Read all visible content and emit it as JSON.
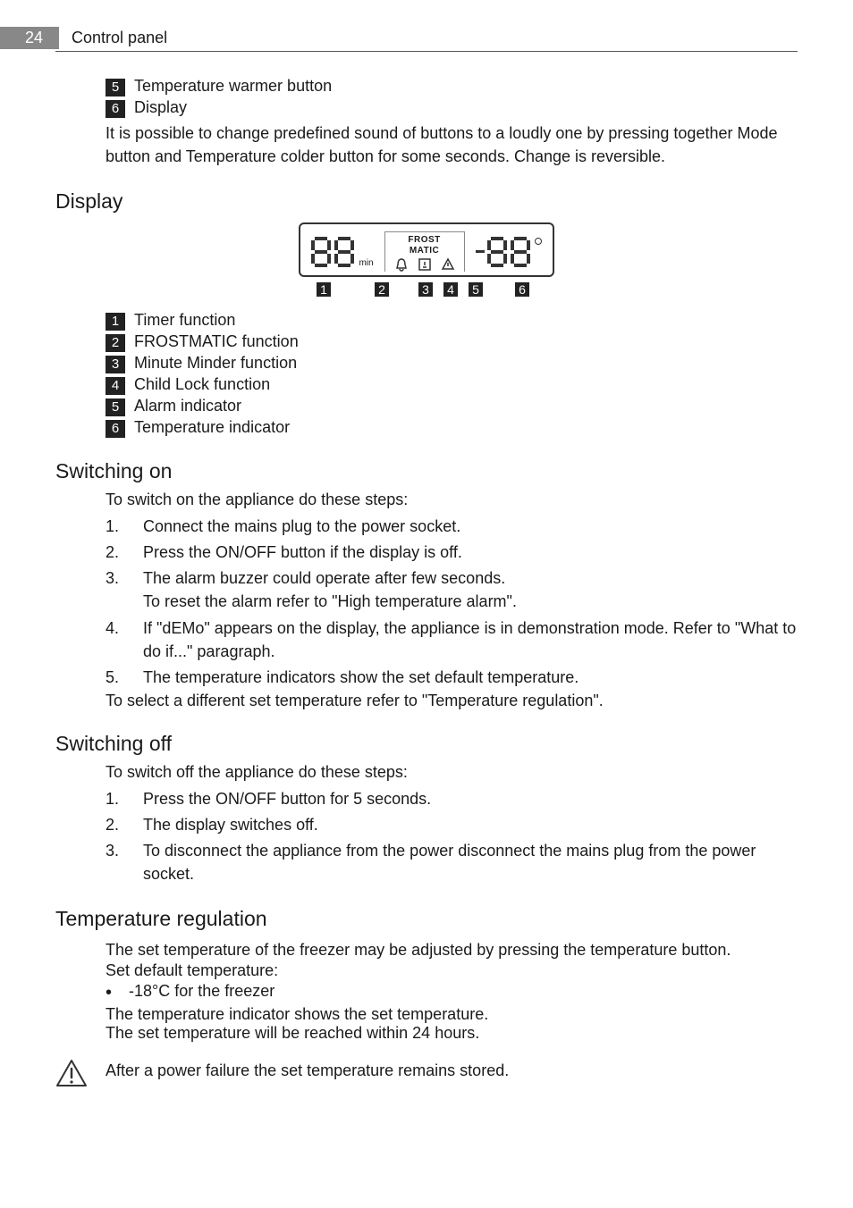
{
  "header": {
    "page_number": "24",
    "section": "Control panel"
  },
  "top_list": [
    {
      "n": "5",
      "label": "Temperature warmer button"
    },
    {
      "n": "6",
      "label": "Display"
    }
  ],
  "intro_paragraph": "It is possible to change predefined sound of buttons to a loudly one by pressing together Mode button and Temperature colder button for some seconds. Change is reversible.",
  "sections": {
    "display": {
      "title": "Display"
    },
    "switching_on": {
      "title": "Switching on",
      "intro": "To switch on the appliance do these steps:",
      "steps": [
        "Connect the mains plug to the power socket.",
        "Press the ON/OFF button if the display is off.",
        "The alarm buzzer could operate after few seconds.\nTo reset the alarm refer to \"High temperature alarm\".",
        "If \"dEMo\" appears on the display, the appliance is in demonstration mode. Refer to \"What to do if...\" paragraph.",
        "The temperature indicators show the set default temperature."
      ],
      "outro": "To select a different set temperature refer to \"Temperature regulation\"."
    },
    "switching_off": {
      "title": "Switching off",
      "intro": "To switch off the appliance do these steps:",
      "steps": [
        "Press the ON/OFF button for 5 seconds.",
        "The display switches off.",
        "To disconnect the appliance from the power disconnect the mains plug from the power socket."
      ]
    },
    "temperature_regulation": {
      "title": "Temperature regulation",
      "p1": "The set temperature of the freezer may be adjusted by pressing the temperature button.",
      "p2": "Set default temperature:",
      "bullet": "-18°C for the freezer",
      "p3": "The temperature indicator shows the set temperature.",
      "p4": "The set temperature will be reached within 24 hours.",
      "note": "After a power failure the set temperature remains stored."
    }
  },
  "display_diagram": {
    "min_label": "min",
    "frost_label_1": "FROST",
    "frost_label_2": "MATIC",
    "callouts": [
      "1",
      "2",
      "3",
      "4",
      "5",
      "6"
    ]
  },
  "display_legend": [
    {
      "n": "1",
      "label": "Timer function"
    },
    {
      "n": "2",
      "label": "FROSTMATIC function"
    },
    {
      "n": "3",
      "label": "Minute Minder function"
    },
    {
      "n": "4",
      "label": "Child Lock function"
    },
    {
      "n": "5",
      "label": "Alarm indicator"
    },
    {
      "n": "6",
      "label": "Temperature indicator"
    }
  ]
}
